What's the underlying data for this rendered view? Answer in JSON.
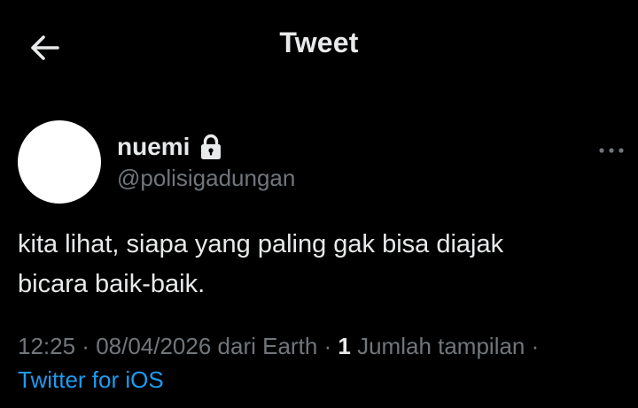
{
  "header": {
    "back_icon": "arrow-left-icon",
    "title": "Tweet"
  },
  "author": {
    "display_name": "nuemi",
    "handle": "@polisigadungan",
    "protected_icon": "lock-icon",
    "avatar_color": "#ffffff"
  },
  "more_icon": "more-horizontal-icon",
  "tweet": {
    "text": "kita lihat, siapa yang paling gak bisa diajak\nbicara baik-baik."
  },
  "meta": {
    "time": "12:25",
    "sep1": " · ",
    "date": "08/04/2026",
    "location": " dari Earth",
    "sep2": " · ",
    "views_count": "1",
    "views_label": " Jumlah tampilan",
    "sep3": " · ",
    "source": "Twitter for iOS"
  },
  "colors": {
    "background": "#000000",
    "primary_text": "#e7e9ea",
    "secondary_text": "#71767b",
    "link": "#1d9bf0"
  }
}
